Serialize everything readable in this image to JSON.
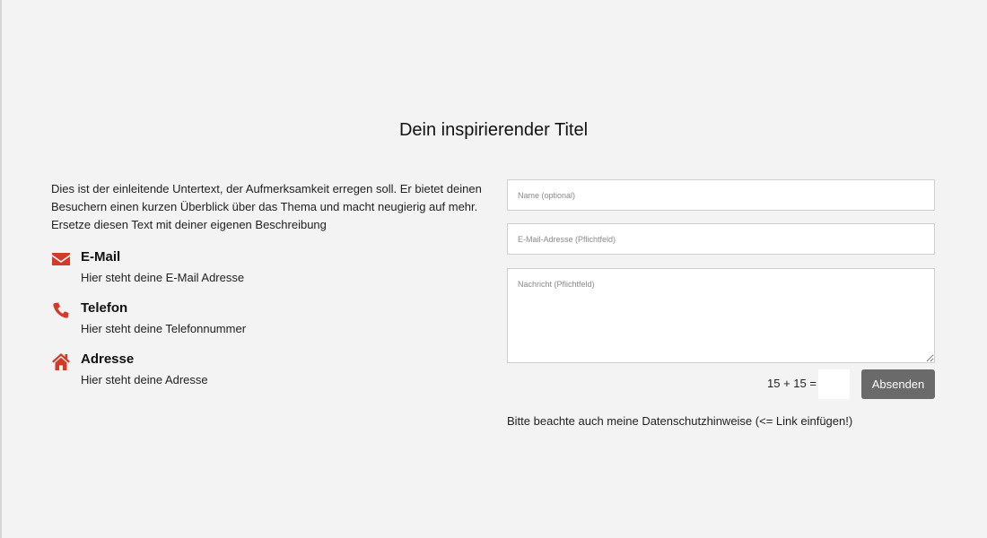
{
  "title": "Dein inspirierender Titel",
  "intro_text": "Dies ist der einleitende Untertext, der Aufmerksamkeit erregen soll. Er bietet deinen Besuchern einen kurzen Überblick über das Thema und macht neugierig auf mehr. Ersetze diesen Text mit deiner eigenen Beschreibung",
  "contacts": [
    {
      "icon": "envelope-icon",
      "heading": "E-Mail",
      "text": "Hier steht deine E-Mail Adresse"
    },
    {
      "icon": "phone-icon",
      "heading": "Telefon",
      "text": "Hier steht deine Telefonnummer"
    },
    {
      "icon": "home-icon",
      "heading": "Adresse",
      "text": "Hier steht deine Adresse"
    }
  ],
  "form": {
    "name_placeholder": "Name (optional)",
    "email_placeholder": "E-Mail-Adresse (Pflichtfeld)",
    "message_placeholder": "Nachricht (Pflichtfeld)",
    "captcha_label": "15 + 15 =",
    "captcha_value": "",
    "submit_label": "Absenden"
  },
  "privacy_note": "Bitte beachte auch meine Datenschutzhinweise (<= Link einfügen!)",
  "colors": {
    "background": "#f3f3f3",
    "accent_icon": "#d23a2a",
    "button": "#6a6a6a"
  }
}
